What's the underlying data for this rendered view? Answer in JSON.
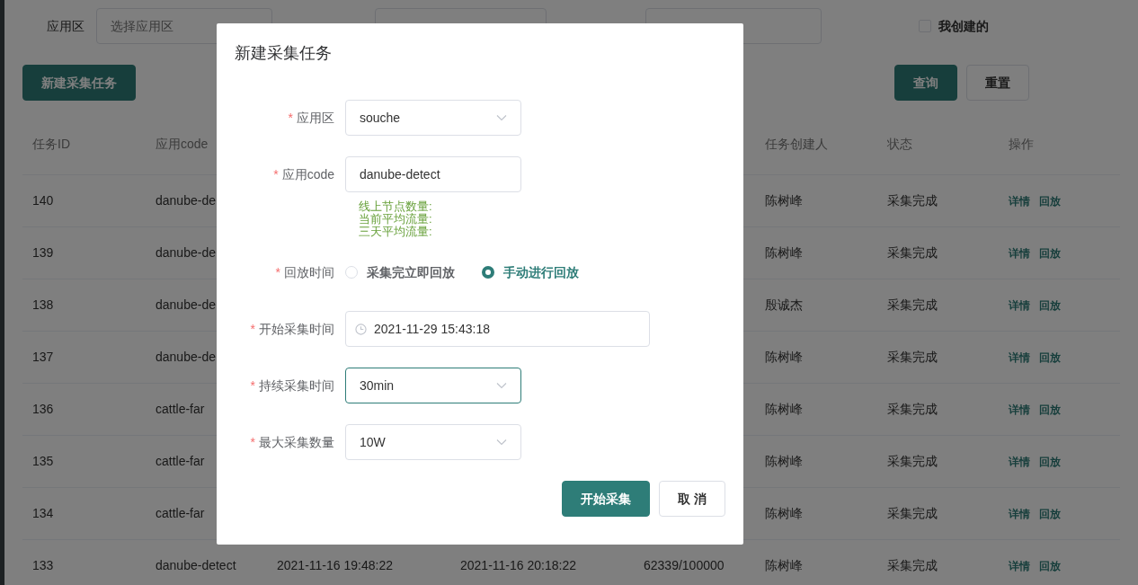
{
  "filter_bar": {
    "app_zone": {
      "label": "应用区",
      "placeholder": "选择应用区"
    },
    "mine_checkbox": {
      "label": "我创建的",
      "checked": false
    }
  },
  "toolbar": {
    "create_button": "新建采集任务",
    "query_button": "查询",
    "reset_button": "重置"
  },
  "table": {
    "header": {
      "id": "任务ID",
      "app_code": "应用code",
      "creator": "任务创建人",
      "status": "状态",
      "actions": "操作"
    },
    "rows": [
      {
        "id": "140",
        "app_code": "danube-de",
        "creator": "陈树峰",
        "status": "采集完成",
        "actions": [
          "详情",
          "回放"
        ]
      },
      {
        "id": "139",
        "app_code": "danube-de",
        "creator": "陈树峰",
        "status": "采集完成",
        "actions": [
          "详情",
          "回放"
        ]
      },
      {
        "id": "138",
        "app_code": "danube-de",
        "creator": "殷诚杰",
        "status": "采集完成",
        "actions": [
          "详情",
          "回放"
        ]
      },
      {
        "id": "137",
        "app_code": "danube-de",
        "creator": "陈树峰",
        "status": "采集完成",
        "actions": [
          "详情",
          "回放"
        ]
      },
      {
        "id": "136",
        "app_code": "cattle-far",
        "creator": "陈树峰",
        "status": "采集完成",
        "actions": [
          "详情",
          "回放"
        ]
      },
      {
        "id": "135",
        "app_code": "cattle-far",
        "creator": "陈树峰",
        "status": "采集完成",
        "actions": [
          "详情",
          "回放"
        ]
      },
      {
        "id": "134",
        "app_code": "cattle-far",
        "creator": "陈树峰",
        "status": "采集完成",
        "actions": [
          "详情",
          "回放"
        ]
      },
      {
        "id": "133",
        "app_code": "danube-detect",
        "start_time": "2021-11-16 19:48:22",
        "end_time": "2021-11-16 20:18:22",
        "count": "62339/100000",
        "creator": "陈树峰",
        "status": "采集完成",
        "actions": [
          "详情",
          "回放"
        ]
      }
    ]
  },
  "modal": {
    "title": "新建采集任务",
    "fields": [
      {
        "kind": "select",
        "mark": "*",
        "label": "应用区",
        "value": "souche",
        "focused": false
      },
      {
        "kind": "input",
        "mark": "*",
        "label": "应用code",
        "value": "danube-detect",
        "focused": false,
        "hints": [
          "线上节点数量:",
          "当前平均流量:",
          "三天平均流量:"
        ]
      },
      {
        "kind": "radio",
        "mark": "*",
        "label": "回放时间",
        "options": [
          {
            "label": "采集完立即回放",
            "selected": false
          },
          {
            "label": "手动进行回放",
            "selected": true
          }
        ]
      },
      {
        "kind": "datetime",
        "mark": "*",
        "label": "开始采集时间",
        "value": "2021-11-29 15:43:18",
        "focused": false
      },
      {
        "kind": "select",
        "mark": "*",
        "label": "持续采集时间",
        "value": "30min",
        "focused": true
      },
      {
        "kind": "select",
        "mark": "*",
        "label": "最大采集数量",
        "value": "10W",
        "focused": false
      }
    ],
    "buttons": [
      {
        "kind": "primary",
        "label": "开始采集"
      },
      {
        "kind": "secondary",
        "label": "取 消"
      }
    ]
  }
}
